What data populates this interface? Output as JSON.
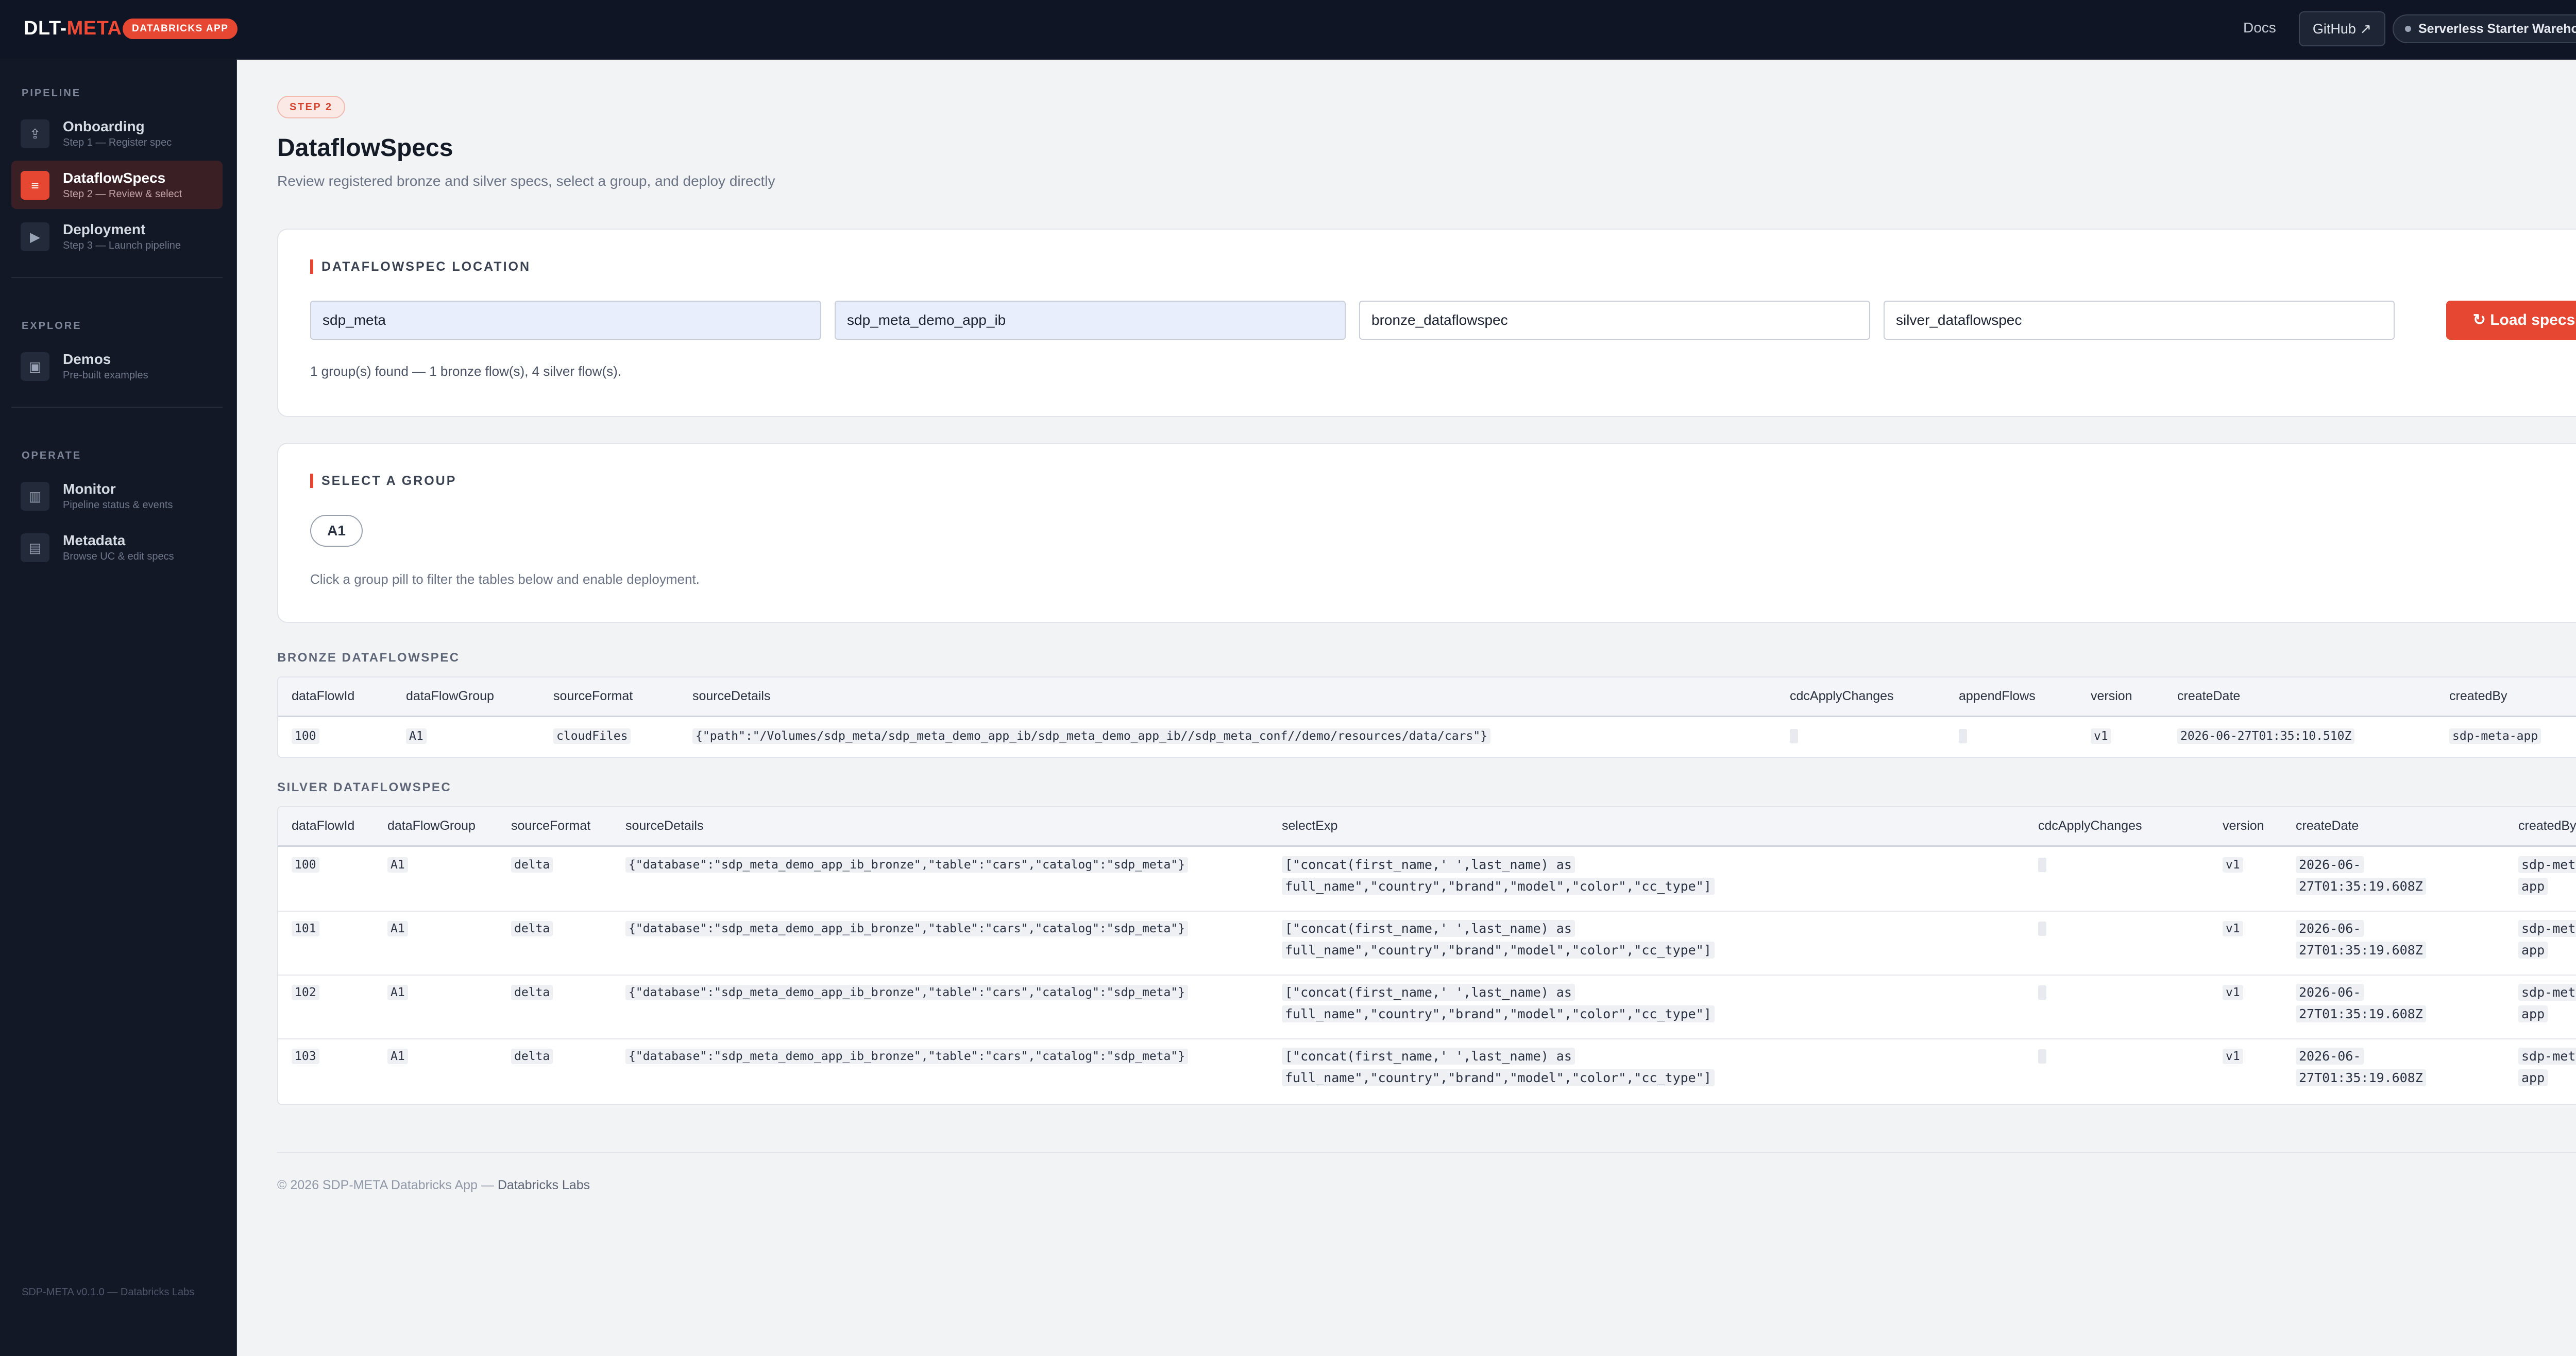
{
  "topbar": {
    "brand_prefix": "DLT-",
    "brand_accent": "META",
    "app_badge": "DATABRICKS APP",
    "docs_label": "Docs",
    "github_label": "GitHub ↗",
    "warehouse_label": "Serverless Starter Warehouse"
  },
  "sidebar": {
    "sections": {
      "pipeline": "PIPELINE",
      "explore": "EXPLORE",
      "operate": "OPERATE"
    },
    "items": [
      {
        "title": "Onboarding",
        "sub": "Step 1 — Register spec",
        "icon": "upload-icon"
      },
      {
        "title": "DataflowSpecs",
        "sub": "Step 2 — Review & select",
        "icon": "list-icon",
        "active": true
      },
      {
        "title": "Deployment",
        "sub": "Step 3 — Launch pipeline",
        "icon": "play-icon"
      },
      {
        "title": "Demos",
        "sub": "Pre-built examples",
        "icon": "monitor-icon"
      },
      {
        "title": "Monitor",
        "sub": "Pipeline status & events",
        "icon": "chart-icon"
      },
      {
        "title": "Metadata",
        "sub": "Browse UC & edit specs",
        "icon": "document-icon"
      }
    ],
    "footer": "SDP-META v0.1.0 — Databricks Labs"
  },
  "page": {
    "step_badge": "STEP 2",
    "title": "DataflowSpecs",
    "subtitle": "Review registered bronze and silver specs, select a group, and deploy directly"
  },
  "location_card": {
    "heading": "DATAFLOWSPEC LOCATION",
    "fields": {
      "catalog": "sdp_meta",
      "schema": "sdp_meta_demo_app_ib",
      "bronze_table": "bronze_dataflowspec",
      "silver_table": "silver_dataflowspec"
    },
    "load_label": "↻ Load specs",
    "status": "1 group(s) found — 1 bronze flow(s), 4 silver flow(s)."
  },
  "group_card": {
    "heading": "SELECT A GROUP",
    "groups": [
      "A1"
    ],
    "hint": "Click a group pill to filter the tables below and enable deployment."
  },
  "bronze": {
    "label": "BRONZE DATAFLOWSPEC",
    "columns": [
      "dataFlowId",
      "dataFlowGroup",
      "sourceFormat",
      "sourceDetails",
      "cdcApplyChanges",
      "appendFlows",
      "version",
      "createDate",
      "createdBy"
    ],
    "rows": [
      {
        "dataFlowId": "100",
        "dataFlowGroup": "A1",
        "sourceFormat": "cloudFiles",
        "sourceDetails": "{\"path\":\"/Volumes/sdp_meta/sdp_meta_demo_app_ib/sdp_meta_demo_app_ib//sdp_meta_conf//demo/resources/data/cars\"}",
        "cdcApplyChanges": "",
        "appendFlows": "",
        "version": "v1",
        "createDate": "2026-06-27T01:35:10.510Z",
        "createdBy": "sdp-meta-app"
      }
    ]
  },
  "silver": {
    "label": "SILVER DATAFLOWSPEC",
    "columns": [
      "dataFlowId",
      "dataFlowGroup",
      "sourceFormat",
      "sourceDetails",
      "selectExp",
      "cdcApplyChanges",
      "version",
      "createDate",
      "createdBy"
    ],
    "rows": [
      {
        "dataFlowId": "100",
        "dataFlowGroup": "A1",
        "sourceFormat": "delta",
        "sourceDetails": "{\"database\":\"sdp_meta_demo_app_ib_bronze\",\"table\":\"cars\",\"catalog\":\"sdp_meta\"}",
        "selectExp_1": "[\"concat(first_name,' ',last_name) as",
        "selectExp_2": "full_name\",\"country\",\"brand\",\"model\",\"color\",\"cc_type\"]",
        "cdcApplyChanges": "",
        "version": "v1",
        "createDate_1": "2026-06-",
        "createDate_2": "27T01:35:19.608Z",
        "createdBy_1": "sdp-meta-",
        "createdBy_2": "app"
      },
      {
        "dataFlowId": "101",
        "dataFlowGroup": "A1",
        "sourceFormat": "delta",
        "sourceDetails": "{\"database\":\"sdp_meta_demo_app_ib_bronze\",\"table\":\"cars\",\"catalog\":\"sdp_meta\"}",
        "selectExp_1": "[\"concat(first_name,' ',last_name) as",
        "selectExp_2": "full_name\",\"country\",\"brand\",\"model\",\"color\",\"cc_type\"]",
        "cdcApplyChanges": "",
        "version": "v1",
        "createDate_1": "2026-06-",
        "createDate_2": "27T01:35:19.608Z",
        "createdBy_1": "sdp-meta-",
        "createdBy_2": "app"
      },
      {
        "dataFlowId": "102",
        "dataFlowGroup": "A1",
        "sourceFormat": "delta",
        "sourceDetails": "{\"database\":\"sdp_meta_demo_app_ib_bronze\",\"table\":\"cars\",\"catalog\":\"sdp_meta\"}",
        "selectExp_1": "[\"concat(first_name,' ',last_name) as",
        "selectExp_2": "full_name\",\"country\",\"brand\",\"model\",\"color\",\"cc_type\"]",
        "cdcApplyChanges": "",
        "version": "v1",
        "createDate_1": "2026-06-",
        "createDate_2": "27T01:35:19.608Z",
        "createdBy_1": "sdp-meta-",
        "createdBy_2": "app"
      },
      {
        "dataFlowId": "103",
        "dataFlowGroup": "A1",
        "sourceFormat": "delta",
        "sourceDetails": "{\"database\":\"sdp_meta_demo_app_ib_bronze\",\"table\":\"cars\",\"catalog\":\"sdp_meta\"}",
        "selectExp_1": "[\"concat(first_name,' ',last_name) as",
        "selectExp_2": "full_name\",\"country\",\"brand\",\"model\",\"color\",\"cc_type\"]",
        "cdcApplyChanges": "",
        "version": "v1",
        "createDate_1": "2026-06-",
        "createDate_2": "27T01:35:19.608Z",
        "createdBy_1": "sdp-meta-",
        "createdBy_2": "app"
      }
    ]
  },
  "footer": {
    "prefix": "© 2026 SDP-META Databricks App — ",
    "link": "Databricks Labs"
  },
  "colors": {
    "accent": "#e54733",
    "topbar_bg": "#0f1524",
    "sidebar_bg": "#121826",
    "page_bg": "#f2f3f5"
  }
}
